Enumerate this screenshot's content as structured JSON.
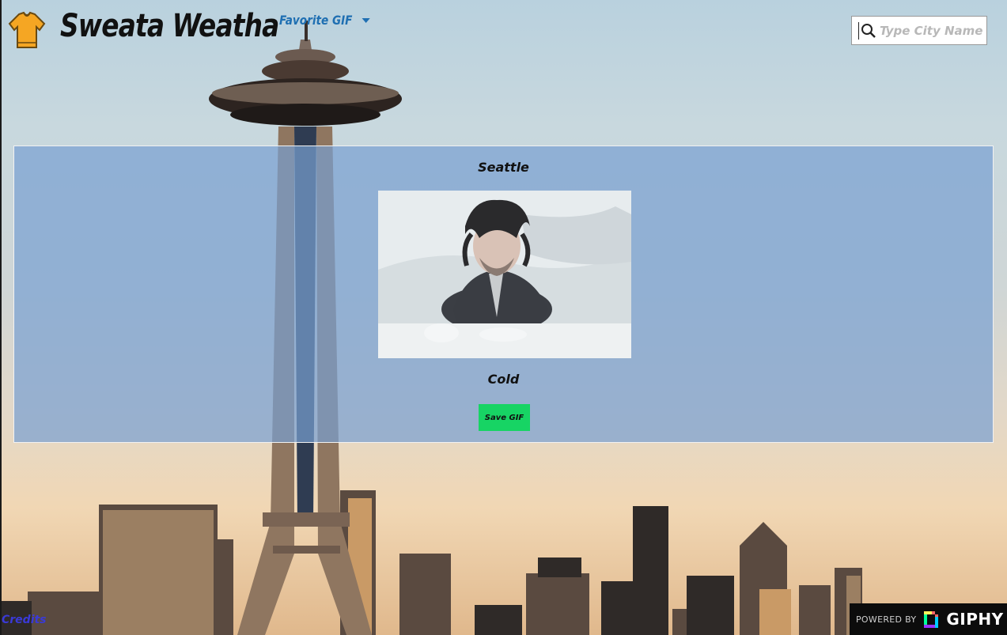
{
  "header": {
    "app_title": "Sweata Weatha",
    "favorite_menu_label": "Favorite GIF",
    "search_placeholder": "Type City Name"
  },
  "main": {
    "city": "Seattle",
    "weather_description": "Cold",
    "save_button_label": "Save GIF"
  },
  "footer": {
    "credits_label": "Credits",
    "giphy_powered_label": "POWERED BY",
    "giphy_brand": "GIPHY"
  },
  "colors": {
    "accent_link": "#1f6fb2",
    "save_button": "#17d464",
    "panel_overlay": "#78a0d2",
    "credits_link": "#3a3ad8",
    "sweater": "#f5a623"
  },
  "icons": [
    "sweater-logo-icon",
    "chevron-down-icon",
    "search-icon",
    "giphy-logo-icon"
  ]
}
